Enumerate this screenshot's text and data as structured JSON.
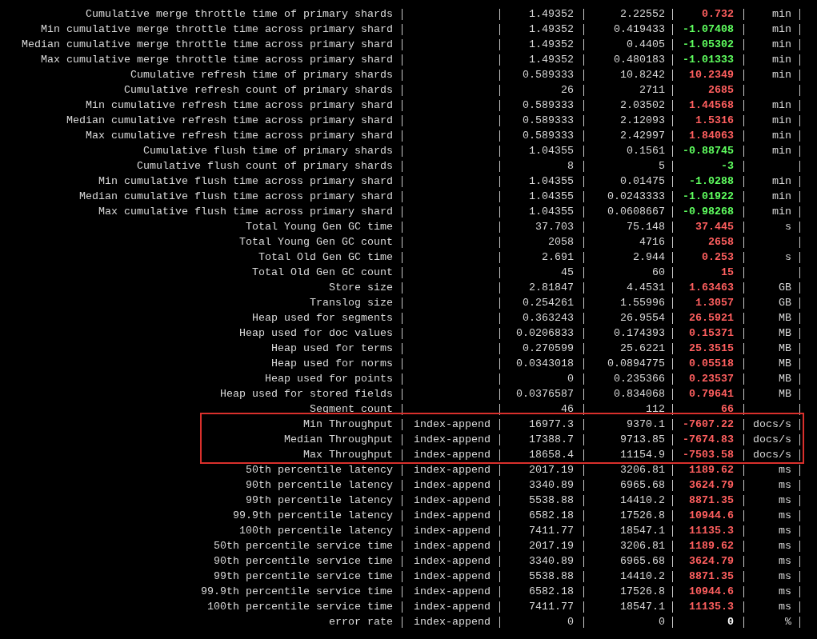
{
  "rows": [
    {
      "metric": "Cumulative merge throttle time of primary shards",
      "baseline": "1.49352",
      "contender": "2.22552",
      "diff": "0.732",
      "unit": "min",
      "color": "#ff5f5f",
      "highlighted": false
    },
    {
      "metric": "Min cumulative merge throttle time across primary shard",
      "baseline": "1.49352",
      "contender": "0.419433",
      "diff": "-1.07408",
      "unit": "min",
      "color": "#5fff5f",
      "highlighted": false
    },
    {
      "metric": "Median cumulative merge throttle time across primary shard",
      "baseline": "1.49352",
      "contender": "0.4405",
      "diff": "-1.05302",
      "unit": "min",
      "color": "#5fff5f",
      "highlighted": false
    },
    {
      "metric": "Max cumulative merge throttle time across primary shard",
      "baseline": "1.49352",
      "contender": "0.480183",
      "diff": "-1.01333",
      "unit": "min",
      "color": "#5fff5f",
      "highlighted": false
    },
    {
      "metric": "Cumulative refresh time of primary shards",
      "baseline": "0.589333",
      "contender": "10.8242",
      "diff": "10.2349",
      "unit": "min",
      "color": "#ff5f5f",
      "highlighted": false
    },
    {
      "metric": "Cumulative refresh count of primary shards",
      "baseline": "26",
      "contender": "2711",
      "diff": "2685",
      "color": "#ff5f5f",
      "highlighted": false
    },
    {
      "metric": "Min cumulative refresh time across primary shard",
      "baseline": "0.589333",
      "contender": "2.03502",
      "diff": "1.44568",
      "unit": "min",
      "color": "#ff5f5f",
      "highlighted": false
    },
    {
      "metric": "Median cumulative refresh time across primary shard",
      "baseline": "0.589333",
      "contender": "2.12093",
      "diff": "1.5316",
      "unit": "min",
      "color": "#ff5f5f",
      "highlighted": false
    },
    {
      "metric": "Max cumulative refresh time across primary shard",
      "baseline": "0.589333",
      "contender": "2.42997",
      "diff": "1.84063",
      "unit": "min",
      "color": "#ff5f5f",
      "highlighted": false
    },
    {
      "metric": "Cumulative flush time of primary shards",
      "baseline": "1.04355",
      "contender": "0.1561",
      "diff": "-0.88745",
      "unit": "min",
      "color": "#5fff5f",
      "highlighted": false
    },
    {
      "metric": "Cumulative flush count of primary shards",
      "baseline": "8",
      "contender": "5",
      "diff": "-3",
      "color": "#5fff5f",
      "highlighted": false
    },
    {
      "metric": "Min cumulative flush time across primary shard",
      "baseline": "1.04355",
      "contender": "0.01475",
      "diff": "-1.0288",
      "unit": "min",
      "color": "#5fff5f",
      "highlighted": false
    },
    {
      "metric": "Median cumulative flush time across primary shard",
      "baseline": "1.04355",
      "contender": "0.0243333",
      "diff": "-1.01922",
      "unit": "min",
      "color": "#5fff5f",
      "highlighted": false
    },
    {
      "metric": "Max cumulative flush time across primary shard",
      "baseline": "1.04355",
      "contender": "0.0608667",
      "diff": "-0.98268",
      "unit": "min",
      "color": "#5fff5f",
      "highlighted": false
    },
    {
      "metric": "Total Young Gen GC time",
      "baseline": "37.703",
      "contender": "75.148",
      "diff": "37.445",
      "unit": "s",
      "color": "#ff5f5f",
      "highlighted": false
    },
    {
      "metric": "Total Young Gen GC count",
      "baseline": "2058",
      "contender": "4716",
      "diff": "2658",
      "color": "#ff5f5f",
      "highlighted": false
    },
    {
      "metric": "Total Old Gen GC time",
      "baseline": "2.691",
      "contender": "2.944",
      "diff": "0.253",
      "unit": "s",
      "color": "#ff5f5f",
      "highlighted": false
    },
    {
      "metric": "Total Old Gen GC count",
      "baseline": "45",
      "contender": "60",
      "diff": "15",
      "color": "#ff5f5f",
      "highlighted": false
    },
    {
      "metric": "Store size",
      "baseline": "2.81847",
      "contender": "4.4531",
      "diff": "1.63463",
      "unit": "GB",
      "color": "#ff5f5f",
      "highlighted": false
    },
    {
      "metric": "Translog size",
      "baseline": "0.254261",
      "contender": "1.55996",
      "diff": "1.3057",
      "unit": "GB",
      "color": "#ff5f5f",
      "highlighted": false
    },
    {
      "metric": "Heap used for segments",
      "baseline": "0.363243",
      "contender": "26.9554",
      "diff": "26.5921",
      "unit": "MB",
      "color": "#ff5f5f",
      "highlighted": false
    },
    {
      "metric": "Heap used for doc values",
      "baseline": "0.0206833",
      "contender": "0.174393",
      "diff": "0.15371",
      "unit": "MB",
      "color": "#ff5f5f",
      "highlighted": false
    },
    {
      "metric": "Heap used for terms",
      "baseline": "0.270599",
      "contender": "25.6221",
      "diff": "25.3515",
      "unit": "MB",
      "color": "#ff5f5f",
      "highlighted": false
    },
    {
      "metric": "Heap used for norms",
      "baseline": "0.0343018",
      "contender": "0.0894775",
      "diff": "0.05518",
      "unit": "MB",
      "color": "#ff5f5f",
      "highlighted": false
    },
    {
      "metric": "Heap used for points",
      "baseline": "0",
      "contender": "0.235366",
      "diff": "0.23537",
      "unit": "MB",
      "color": "#ff5f5f",
      "highlighted": false
    },
    {
      "metric": "Heap used for stored fields",
      "baseline": "0.0376587",
      "contender": "0.834068",
      "diff": "0.79641",
      "unit": "MB",
      "color": "#ff5f5f",
      "highlighted": false
    },
    {
      "metric": "Segment count",
      "baseline": "46",
      "contender": "112",
      "diff": "66",
      "color": "#ff5f5f",
      "highlighted": false
    },
    {
      "metric": "Min Throughput",
      "task": "index-append",
      "baseline": "16977.3",
      "contender": "9370.1",
      "diff": "-7607.22",
      "unit": "docs/s",
      "color": "#ff5f5f",
      "highlighted": true
    },
    {
      "metric": "Median Throughput",
      "task": "index-append",
      "baseline": "17388.7",
      "contender": "9713.85",
      "diff": "-7674.83",
      "unit": "docs/s",
      "color": "#ff5f5f",
      "highlighted": true
    },
    {
      "metric": "Max Throughput",
      "task": "index-append",
      "baseline": "18658.4",
      "contender": "11154.9",
      "diff": "-7503.58",
      "unit": "docs/s",
      "color": "#ff5f5f",
      "highlighted": true
    },
    {
      "metric": "50th percentile latency",
      "task": "index-append",
      "baseline": "2017.19",
      "contender": "3206.81",
      "diff": "1189.62",
      "unit": "ms",
      "color": "#ff5f5f",
      "highlighted": false
    },
    {
      "metric": "90th percentile latency",
      "task": "index-append",
      "baseline": "3340.89",
      "contender": "6965.68",
      "diff": "3624.79",
      "unit": "ms",
      "color": "#ff5f5f",
      "highlighted": false
    },
    {
      "metric": "99th percentile latency",
      "task": "index-append",
      "baseline": "5538.88",
      "contender": "14410.2",
      "diff": "8871.35",
      "unit": "ms",
      "color": "#ff5f5f",
      "highlighted": false
    },
    {
      "metric": "99.9th percentile latency",
      "task": "index-append",
      "baseline": "6582.18",
      "contender": "17526.8",
      "diff": "10944.6",
      "unit": "ms",
      "color": "#ff5f5f",
      "highlighted": false
    },
    {
      "metric": "100th percentile latency",
      "task": "index-append",
      "baseline": "7411.77",
      "contender": "18547.1",
      "diff": "11135.3",
      "unit": "ms",
      "color": "#ff5f5f",
      "highlighted": false
    },
    {
      "metric": "50th percentile service time",
      "task": "index-append",
      "baseline": "2017.19",
      "contender": "3206.81",
      "diff": "1189.62",
      "unit": "ms",
      "color": "#ff5f5f",
      "highlighted": false
    },
    {
      "metric": "90th percentile service time",
      "task": "index-append",
      "baseline": "3340.89",
      "contender": "6965.68",
      "diff": "3624.79",
      "unit": "ms",
      "color": "#ff5f5f",
      "highlighted": false
    },
    {
      "metric": "99th percentile service time",
      "task": "index-append",
      "baseline": "5538.88",
      "contender": "14410.2",
      "diff": "8871.35",
      "unit": "ms",
      "color": "#ff5f5f",
      "highlighted": false
    },
    {
      "metric": "99.9th percentile service time",
      "task": "index-append",
      "baseline": "6582.18",
      "contender": "17526.8",
      "diff": "10944.6",
      "unit": "ms",
      "color": "#ff5f5f",
      "highlighted": false
    },
    {
      "metric": "100th percentile service time",
      "task": "index-append",
      "baseline": "7411.77",
      "contender": "18547.1",
      "diff": "11135.3",
      "unit": "ms",
      "color": "#ff5f5f",
      "highlighted": false
    },
    {
      "metric": "error rate",
      "task": "index-append",
      "baseline": "0",
      "contender": "0",
      "diff": "0",
      "unit": "%",
      "color": "#ffffff",
      "highlighted": false
    }
  ]
}
